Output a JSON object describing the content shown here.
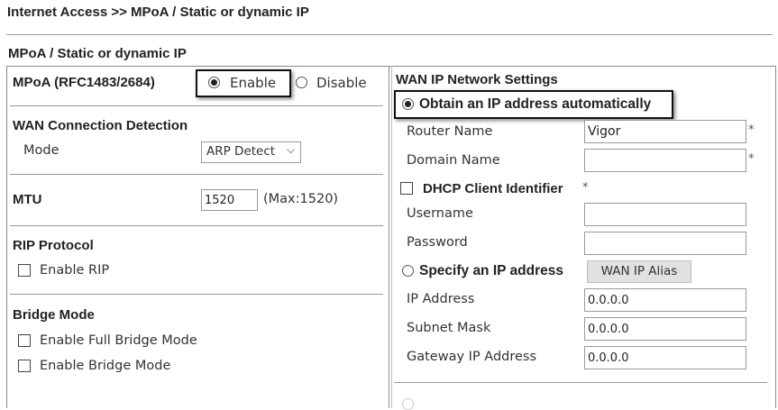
{
  "breadcrumb": "Internet Access >> MPoA / Static or dynamic IP",
  "section_title": "MPoA / Static or dynamic IP",
  "left": {
    "mpoa_label": "MPoA (RFC1483/2684)",
    "enable": "Enable",
    "disable": "Disable",
    "mpoa_selected": "Enable",
    "wan_detection": "WAN Connection Detection",
    "mode_label": "Mode",
    "mode_value": "ARP Detect",
    "mtu_label": "MTU",
    "mtu_value": "1520",
    "mtu_max": "(Max:1520)",
    "rip_title": "RIP Protocol",
    "rip_enable": "Enable RIP",
    "bridge_title": "Bridge Mode",
    "full_bridge": "Enable Full Bridge Mode",
    "bridge": "Enable Bridge Mode"
  },
  "right": {
    "title": "WAN IP Network Settings",
    "obtain": "Obtain an IP address automatically",
    "router_name_label": "Router Name",
    "router_name": "Vigor",
    "domain_name_label": "Domain Name",
    "domain_name": "",
    "asterisk": "*",
    "dhcp_client_id": "DHCP Client Identifier",
    "username_label": "Username",
    "password_label": "Password",
    "specify": "Specify an IP address",
    "alias_button": "WAN IP Alias",
    "ip_label": "IP Address",
    "ip": "0.0.0.0",
    "mask_label": "Subnet Mask",
    "mask": "0.0.0.0",
    "gateway_label": "Gateway IP Address",
    "gateway": "0.0.0.0"
  }
}
